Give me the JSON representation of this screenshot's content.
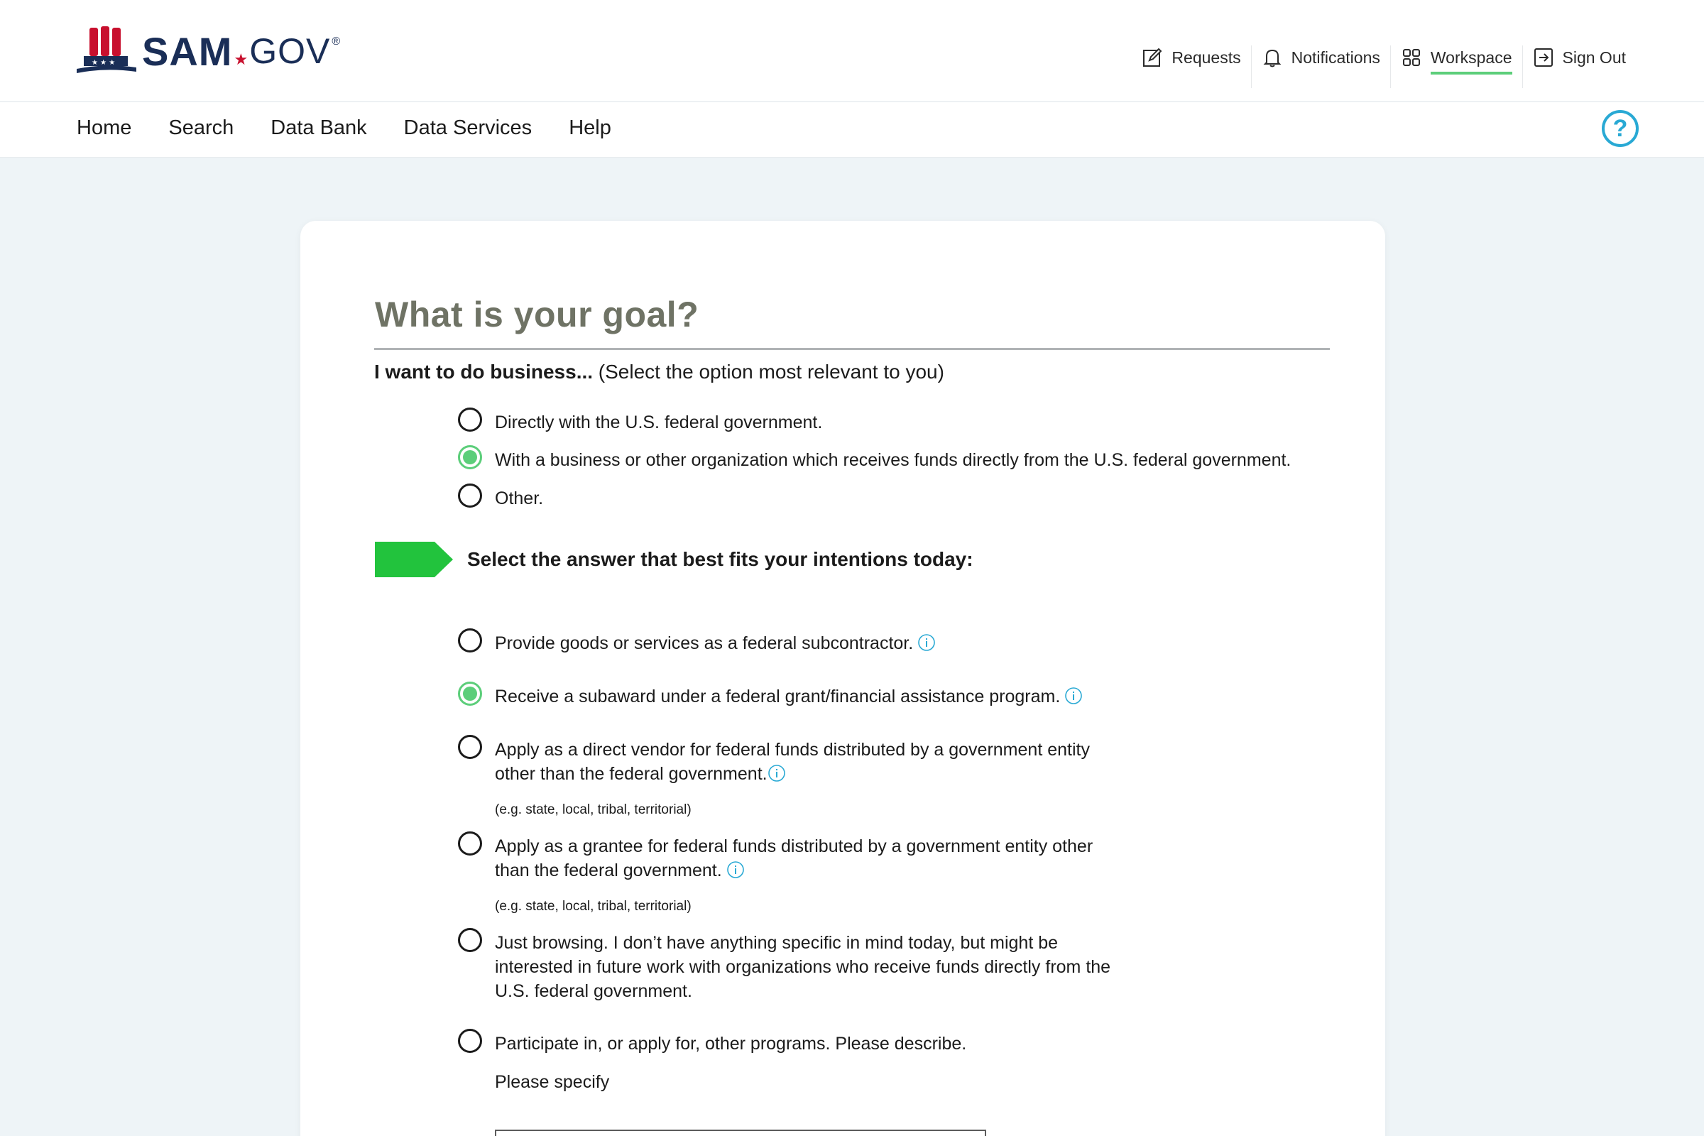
{
  "header": {
    "logo_sam": "SAM",
    "logo_gov": "GOV",
    "logo_reg": "®",
    "util": [
      {
        "label": "Requests",
        "icon": "edit-icon"
      },
      {
        "label": "Notifications",
        "icon": "bell-icon"
      },
      {
        "label": "Workspace",
        "icon": "grid-icon",
        "active": true
      },
      {
        "label": "Sign Out",
        "icon": "sign-out-icon"
      }
    ]
  },
  "nav": {
    "links": [
      "Home",
      "Search",
      "Data Bank",
      "Data Services",
      "Help"
    ],
    "help_glyph": "?"
  },
  "goal": {
    "title": "What is your goal?",
    "question_bold": "I want to do business...",
    "question_rest": " (Select the option most relevant to you)",
    "options": [
      {
        "label": "Directly with the U.S. federal government.",
        "checked": false
      },
      {
        "label": "With a business or other organization which receives funds directly from the U.S. federal government.",
        "checked": true
      },
      {
        "label": "Other.",
        "checked": false
      }
    ]
  },
  "intent": {
    "heading": "Select the answer that best fits your intentions today:",
    "options": [
      {
        "line1": "Provide goods or services as a federal subcontractor.",
        "checked": false,
        "info": true
      },
      {
        "line1": "Receive a subaward under a federal grant/financial assistance program.",
        "checked": true,
        "info": true
      },
      {
        "line1": "Apply as a direct vendor for federal funds distributed by a government entity",
        "line2": "other than the federal government.",
        "checked": false,
        "info": true,
        "hint": "(e.g. state, local, tribal, territorial)"
      },
      {
        "line1": "Apply as a grantee for federal funds distributed by a government entity other",
        "line2": "than the federal government.",
        "checked": false,
        "info": true,
        "hint": "(e.g. state, local, tribal, territorial)"
      },
      {
        "line1": "Just browsing. I don’t have anything specific in mind today, but might be",
        "line2": "interested in future work with organizations who receive funds directly from the",
        "line3": "U.S. federal government.",
        "checked": false,
        "info": false
      },
      {
        "line1": "Participate in, or apply for, other programs. Please describe.",
        "checked": false,
        "info": false
      }
    ],
    "specify_label": "Please specify",
    "specify_value": ""
  },
  "colors": {
    "accent_green": "#5cce7a",
    "flag_green": "#22c33d",
    "info_blue": "#29a9d4",
    "title_gray": "#6f7365",
    "page_bg": "#eef4f7"
  }
}
